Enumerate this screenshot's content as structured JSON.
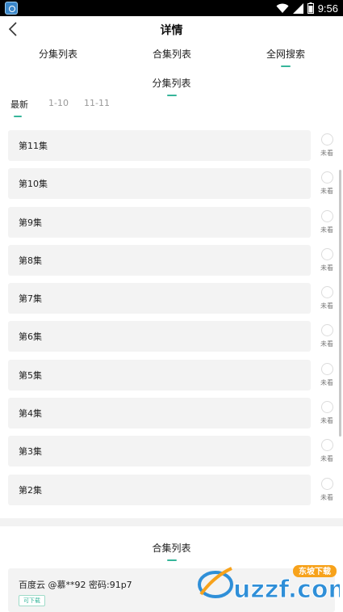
{
  "status_bar": {
    "time": "9:56"
  },
  "header": {
    "title": "详情"
  },
  "top_tabs": [
    {
      "label": "分集列表",
      "active": false
    },
    {
      "label": "合集列表",
      "active": false
    },
    {
      "label": "全网搜索",
      "active": true
    }
  ],
  "episode_section": {
    "title": "分集列表"
  },
  "episode_tabs": [
    {
      "label": "最新",
      "active": true
    },
    {
      "label": "1-10",
      "active": false
    },
    {
      "label": "11-11",
      "active": false
    }
  ],
  "episodes": [
    {
      "title": "第11集",
      "status": "未看"
    },
    {
      "title": "第10集",
      "status": "未看"
    },
    {
      "title": "第9集",
      "status": "未看"
    },
    {
      "title": "第8集",
      "status": "未看"
    },
    {
      "title": "第7集",
      "status": "未看"
    },
    {
      "title": "第6集",
      "status": "未看"
    },
    {
      "title": "第5集",
      "status": "未看"
    },
    {
      "title": "第4集",
      "status": "未看"
    },
    {
      "title": "第3集",
      "status": "未看"
    },
    {
      "title": "第2集",
      "status": "未看"
    }
  ],
  "collection_section": {
    "title": "合集列表"
  },
  "collections": [
    {
      "title": "百度云 @慕**92 密码:91p7",
      "badge": "可下载"
    }
  ],
  "watermark": {
    "text": "uzzf.com",
    "tag": "东坡下载"
  },
  "colors": {
    "accent": "#36b59a",
    "card_bg": "#f3f3f3",
    "status_bar": "#000000"
  }
}
